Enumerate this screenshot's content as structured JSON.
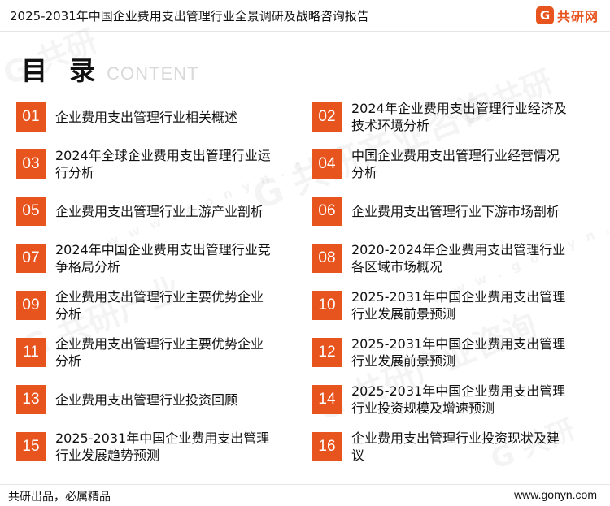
{
  "header": {
    "report_title": "2025-2031年中国企业费用支出管理行业全景调研及战略咨询报告",
    "logo_text": "共研网"
  },
  "toc": {
    "title": "目 录",
    "subtitle": "CONTENT",
    "items": [
      {
        "num": "01",
        "label": "企业费用支出管理行业相关概述"
      },
      {
        "num": "02",
        "label": "2024年企业费用支出管理行业经济及技术环境分析"
      },
      {
        "num": "03",
        "label": "2024年全球企业费用支出管理行业运行分析"
      },
      {
        "num": "04",
        "label": "中国企业费用支出管理行业经营情况分析"
      },
      {
        "num": "05",
        "label": "企业费用支出管理行业上游产业剖析"
      },
      {
        "num": "06",
        "label": "企业费用支出管理行业下游市场剖析"
      },
      {
        "num": "07",
        "label": "2024年中国企业费用支出管理行业竞争格局分析"
      },
      {
        "num": "08",
        "label": "2020-2024年企业费用支出管理行业各区域市场概况"
      },
      {
        "num": "09",
        "label": "企业费用支出管理行业主要优势企业分析"
      },
      {
        "num": "10",
        "label": "2025-2031年中国企业费用支出管理行业发展前景预测"
      },
      {
        "num": "11",
        "label": "企业费用支出管理行业主要优势企业分析"
      },
      {
        "num": "12",
        "label": "2025-2031年中国企业费用支出管理行业发展前景预测"
      },
      {
        "num": "13",
        "label": "企业费用支出管理行业投资回顾"
      },
      {
        "num": "14",
        "label": "2025-2031年中国企业费用支出管理行业投资规模及增速预测"
      },
      {
        "num": "15",
        "label": "2025-2031年中国企业费用支出管理行业发展趋势预测"
      },
      {
        "num": "16",
        "label": "企业费用支出管理行业投资现状及建议"
      }
    ]
  },
  "footer": {
    "slogan": "共研出品，必属精品",
    "url": "www.gonyn.com"
  },
  "colors": {
    "accent": "#e8541e"
  }
}
